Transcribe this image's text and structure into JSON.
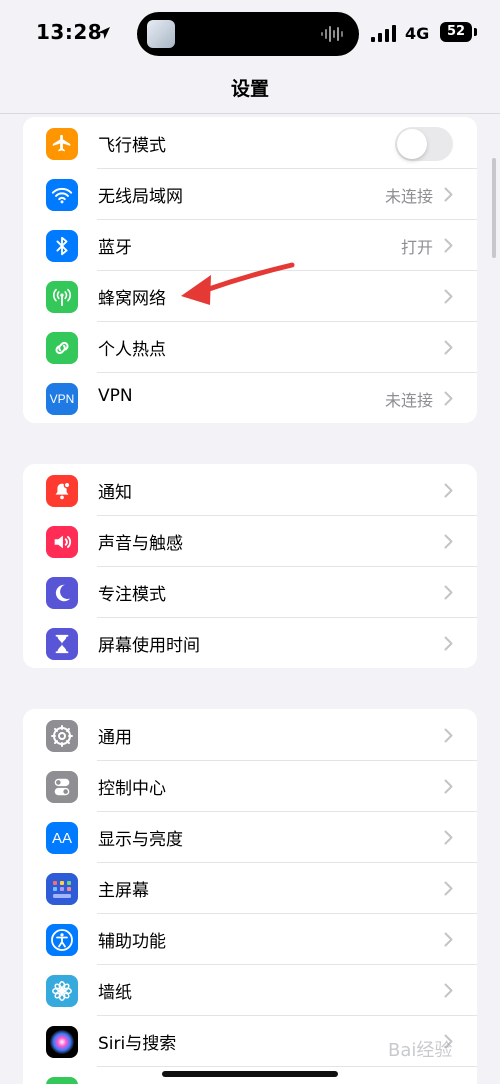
{
  "status_bar": {
    "time": "13:28",
    "network": "4G",
    "battery": "52"
  },
  "header": {
    "title": "设置"
  },
  "groups": [
    {
      "items": [
        {
          "label": "飞行模式",
          "icon": "airplane-icon",
          "color": "#ff9500",
          "control": "toggle",
          "toggle_on": false
        },
        {
          "label": "无线局域网",
          "value": "未连接",
          "icon": "wifi-icon",
          "color": "#007aff"
        },
        {
          "label": "蓝牙",
          "value": "打开",
          "icon": "bluetooth-icon",
          "color": "#007aff"
        },
        {
          "label": "蜂窝网络",
          "value": "",
          "icon": "cellular-icon",
          "color": "#34c759"
        },
        {
          "label": "个人热点",
          "value": "",
          "icon": "hotspot-icon",
          "color": "#34c759"
        },
        {
          "label": "VPN",
          "value": "未连接",
          "icon": "vpn-icon",
          "color": "#1f7be3",
          "icon_text": "VPN"
        }
      ]
    },
    {
      "items": [
        {
          "label": "通知",
          "icon": "notification-bell-icon",
          "color": "#ff3b30"
        },
        {
          "label": "声音与触感",
          "icon": "speaker-icon",
          "color": "#ff2d55"
        },
        {
          "label": "专注模式",
          "icon": "moon-icon",
          "color": "#5856d6"
        },
        {
          "label": "屏幕使用时间",
          "icon": "hourglass-icon",
          "color": "#5856d6"
        }
      ]
    },
    {
      "items": [
        {
          "label": "通用",
          "icon": "gear-icon",
          "color": "#8e8e93"
        },
        {
          "label": "控制中心",
          "icon": "toggles-icon",
          "color": "#8e8e93"
        },
        {
          "label": "显示与亮度",
          "icon": "text-size-icon",
          "color": "#007aff",
          "icon_text": "AA"
        },
        {
          "label": "主屏幕",
          "icon": "home-grid-icon",
          "color": "#2e5cd6"
        },
        {
          "label": "辅助功能",
          "icon": "accessibility-icon",
          "color": "#007aff"
        },
        {
          "label": "墙纸",
          "icon": "flower-icon",
          "color": "#36aadc"
        },
        {
          "label": "Siri与搜索",
          "icon": "siri-icon",
          "color": "#000000"
        }
      ]
    }
  ],
  "watermark": {
    "text": "Bai经验"
  }
}
